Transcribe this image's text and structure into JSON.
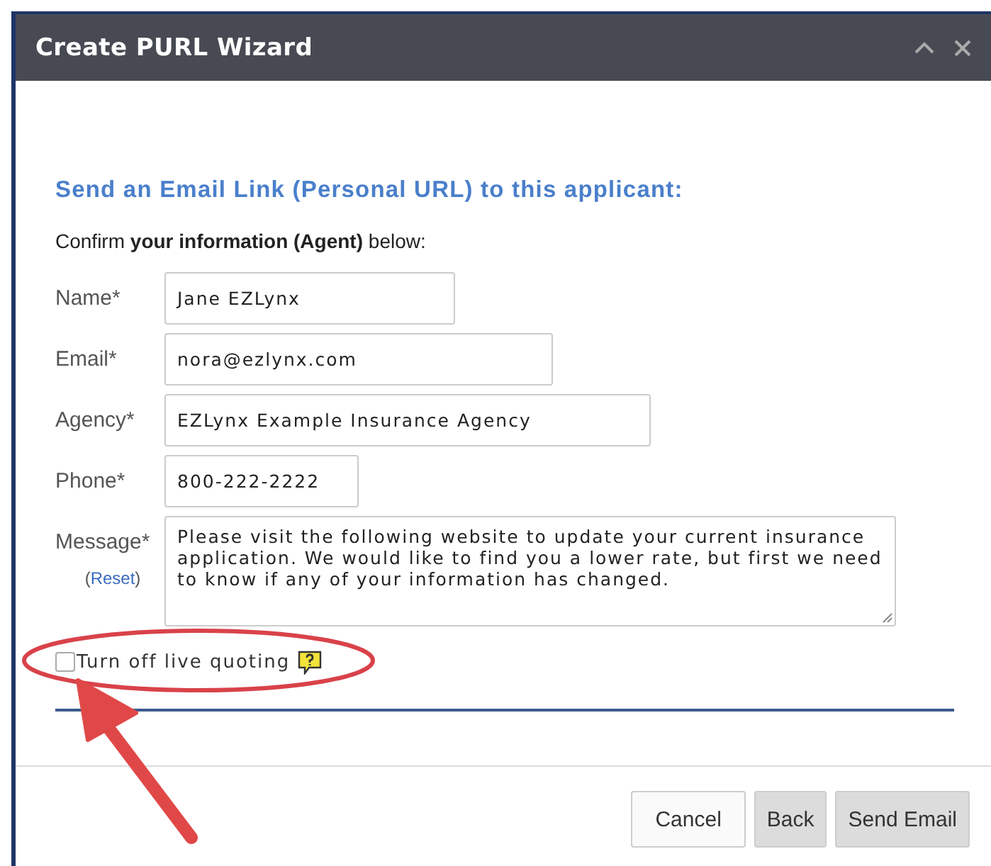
{
  "window": {
    "title": "Create PURL Wizard"
  },
  "heading": "Send an Email Link (Personal URL) to this applicant:",
  "intro": "Confirm **your information (Agent)** below:",
  "fields": [
    {
      "label": "Name*",
      "kind": "input",
      "value": "Jane EZLynx"
    },
    {
      "label": "Email*",
      "kind": "input",
      "value": "nora@ezlynx.com"
    },
    {
      "label": "Agency*",
      "kind": "input",
      "value": "EZLynx Example Insurance Agency"
    },
    {
      "label": "Phone*",
      "kind": "input",
      "value": "800-222-2222"
    },
    {
      "label": "Message*",
      "kind": "textarea",
      "value": "Please visit the following website to update your current insurance application. We would like to find you a lower rate, but first we need to know if any of your information has changed.",
      "reset": {
        "before": "(",
        "link": "Reset",
        "after": ")"
      }
    }
  ],
  "live_quoting": {
    "label": "Turn off live quoting",
    "checked": false
  },
  "buttons": [
    {
      "label": "Cancel",
      "kind": "plain"
    },
    {
      "label": "Back",
      "kind": "shaded"
    },
    {
      "label": "Send Email",
      "kind": "shaded"
    }
  ]
}
